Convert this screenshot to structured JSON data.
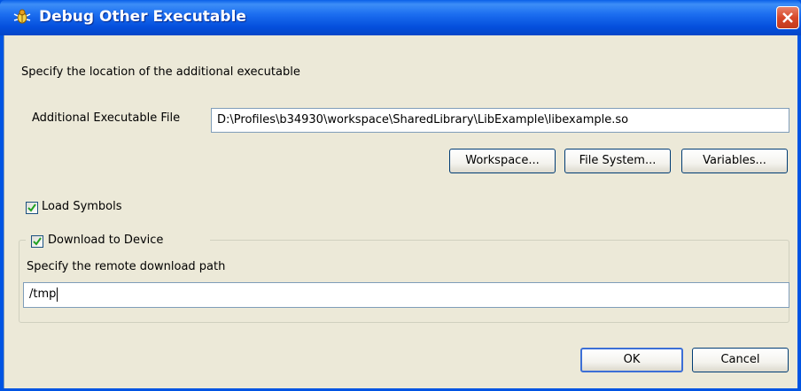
{
  "window": {
    "title": "Debug Other Executable",
    "icons": {
      "app": "debug-bug-icon",
      "close": "close-icon"
    }
  },
  "description": "Specify the location of the additional executable",
  "executable": {
    "label": "Additional Executable File",
    "value": "D:\\Profiles\\b34930\\workspace\\SharedLibrary\\LibExample\\libexample.so"
  },
  "browse_buttons": {
    "workspace": "Workspace...",
    "file_system": "File System...",
    "variables": "Variables..."
  },
  "load_symbols": {
    "label": "Load Symbols",
    "checked": true
  },
  "download": {
    "label": "Download to Device",
    "checked": true,
    "path_label": "Specify the remote download path",
    "path_value": "/tmp"
  },
  "footer": {
    "ok": "OK",
    "cancel": "Cancel"
  },
  "colors": {
    "titlebar": "#0054e3",
    "client": "#ece9d8",
    "close": "#d7482a",
    "check": "#21a121"
  }
}
